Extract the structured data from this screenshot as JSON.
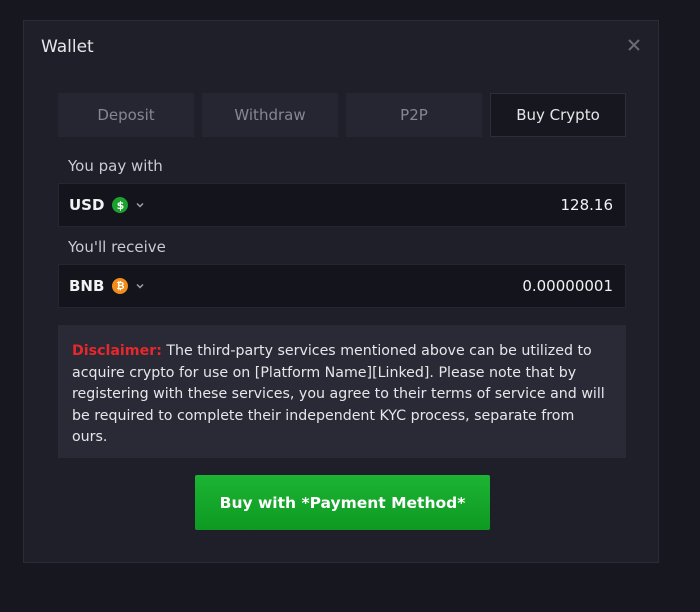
{
  "modal": {
    "title": "Wallet",
    "close_icon": "close-icon"
  },
  "tabs": [
    {
      "label": "Deposit",
      "active": false
    },
    {
      "label": "Withdraw",
      "active": false
    },
    {
      "label": "P2P",
      "active": false
    },
    {
      "label": "Buy Crypto",
      "active": true
    }
  ],
  "pay": {
    "label": "You pay with",
    "currency": "USD",
    "coin_icon": "dollar-coin-icon",
    "coin_color": "#1aa12e",
    "amount": "128.16"
  },
  "receive": {
    "label": "You'll receive",
    "currency": "BNB",
    "coin_icon": "bitcoin-coin-icon",
    "coin_color": "#f28c1b",
    "amount": "0.00000001"
  },
  "disclaimer": {
    "heading": "Disclaimer:",
    "text": " The third-party services mentioned above can be utilized to acquire crypto for use on [Platform Name][Linked]. Please note that by registering with these services, you agree to their terms of service and will be required to complete their independent KYC process, separate from ours."
  },
  "buy_button": {
    "label": "Buy with *Payment Method*",
    "color": "#15a82b"
  }
}
